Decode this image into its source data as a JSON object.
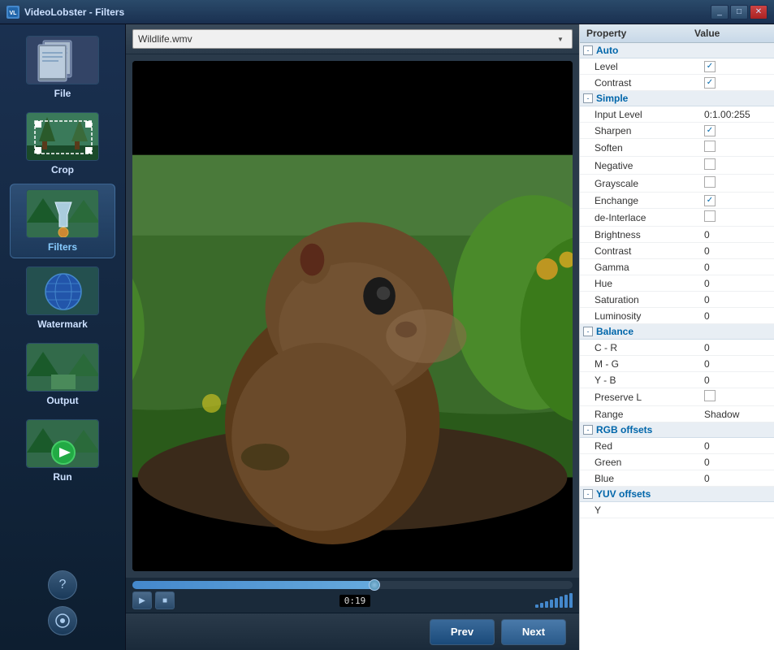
{
  "titlebar": {
    "title": "VideoLobster - Filters",
    "icon": "VL",
    "controls": [
      "_",
      "□",
      "✕"
    ]
  },
  "sidebar": {
    "items": [
      {
        "id": "file",
        "label": "File",
        "active": false
      },
      {
        "id": "crop",
        "label": "Crop",
        "active": false
      },
      {
        "id": "filters",
        "label": "Filters",
        "active": true
      },
      {
        "id": "watermark",
        "label": "Watermark",
        "active": false
      },
      {
        "id": "output",
        "label": "Output",
        "active": false
      },
      {
        "id": "run",
        "label": "Run",
        "active": false
      }
    ],
    "bottom_icons": [
      "?",
      "⊙"
    ]
  },
  "file_bar": {
    "selected_file": "Wildlife.wmv",
    "dropdown_arrow": "▼"
  },
  "video": {
    "time_display": "0:19"
  },
  "controls": {
    "play_icon": "▶",
    "stop_icon": "■"
  },
  "navigation": {
    "prev_label": "Prev",
    "next_label": "Next"
  },
  "panel": {
    "header": {
      "property_col": "Property",
      "value_col": "Value"
    },
    "sections": [
      {
        "name": "Auto",
        "collapsed": false,
        "rows": [
          {
            "name": "Level",
            "type": "checkbox",
            "checked": true,
            "value": ""
          },
          {
            "name": "Contrast",
            "type": "checkbox",
            "checked": true,
            "value": ""
          }
        ]
      },
      {
        "name": "Simple",
        "collapsed": false,
        "rows": [
          {
            "name": "Input Level",
            "type": "text",
            "value": "0:1.00:255"
          },
          {
            "name": "Sharpen",
            "type": "checkbox",
            "checked": true,
            "value": ""
          },
          {
            "name": "Soften",
            "type": "checkbox",
            "checked": false,
            "value": ""
          },
          {
            "name": "Negative",
            "type": "checkbox",
            "checked": false,
            "value": ""
          },
          {
            "name": "Grayscale",
            "type": "checkbox",
            "checked": false,
            "value": ""
          },
          {
            "name": "Enchange",
            "type": "checkbox",
            "checked": true,
            "value": ""
          },
          {
            "name": "de-Interlace",
            "type": "checkbox",
            "checked": false,
            "value": ""
          },
          {
            "name": "Brightness",
            "type": "text",
            "value": "0"
          },
          {
            "name": "Contrast",
            "type": "text",
            "value": "0"
          },
          {
            "name": "Gamma",
            "type": "text",
            "value": "0"
          },
          {
            "name": "Hue",
            "type": "text",
            "value": "0"
          },
          {
            "name": "Saturation",
            "type": "text",
            "value": "0"
          },
          {
            "name": "Luminosity",
            "type": "text",
            "value": "0"
          }
        ]
      },
      {
        "name": "Balance",
        "collapsed": false,
        "rows": [
          {
            "name": "C - R",
            "type": "text",
            "value": "0"
          },
          {
            "name": "M - G",
            "type": "text",
            "value": "0"
          },
          {
            "name": "Y - B",
            "type": "text",
            "value": "0"
          },
          {
            "name": "Preserve L",
            "type": "checkbox",
            "checked": false,
            "value": ""
          },
          {
            "name": "Range",
            "type": "text",
            "value": "Shadow"
          }
        ]
      },
      {
        "name": "RGB offsets",
        "collapsed": false,
        "rows": [
          {
            "name": "Red",
            "type": "text",
            "value": "0"
          },
          {
            "name": "Green",
            "type": "text",
            "value": "0"
          },
          {
            "name": "Blue",
            "type": "text",
            "value": "0"
          }
        ]
      },
      {
        "name": "YUV offsets",
        "collapsed": false,
        "rows": [
          {
            "name": "Y",
            "type": "text",
            "value": ""
          }
        ]
      }
    ]
  }
}
